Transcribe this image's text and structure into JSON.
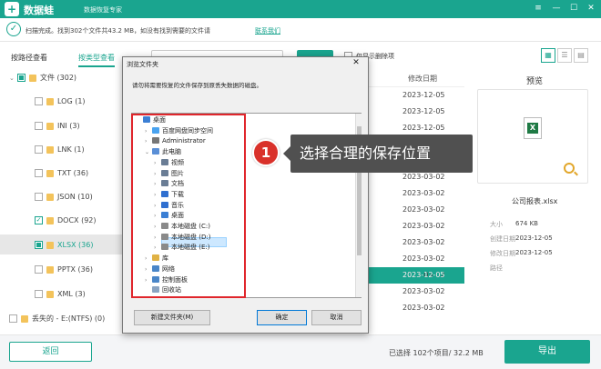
{
  "app": {
    "name": "数据蛙",
    "subtitle": "数据恢复专家",
    "logo": "+"
  },
  "window_controls": {
    "menu": "≡",
    "minimize": "—",
    "maximize": "☐",
    "close": "✕"
  },
  "status": {
    "text": "扫描完成。找到302个文件共43.2 MB，如没有找到需要的文件请",
    "link": "联系我们"
  },
  "tabs": [
    {
      "label": "按路径查看"
    },
    {
      "label": "按类型查看"
    }
  ],
  "toolbar": {
    "checkbox_label": "仅显示删除项"
  },
  "view_buttons": [
    "▦",
    "☰",
    "▤"
  ],
  "tree": {
    "root_label": "文件 (302)",
    "items": [
      {
        "label": "LOG (1)",
        "checked": false
      },
      {
        "label": "INI (3)",
        "checked": false
      },
      {
        "label": "LNK (1)",
        "checked": false
      },
      {
        "label": "TXT (36)",
        "checked": false
      },
      {
        "label": "JSON (10)",
        "checked": false
      },
      {
        "label": "DOCX (92)",
        "checked": true
      },
      {
        "label": "XLSX (36)",
        "checked": true
      },
      {
        "label": "PPTX (36)",
        "checked": false
      },
      {
        "label": "XML (3)",
        "checked": false
      }
    ],
    "lost_label": "丢失的 - E:(NTFS) (0)"
  },
  "list": {
    "header": "修改日期",
    "dates": [
      "2023-12-05",
      "2023-12-05",
      "2023-12-05",
      "2023-12-05",
      "2023-03-02",
      "2023-03-02",
      "2023-03-02",
      "2023-03-02",
      "2023-03-02",
      "2023-03-02",
      "2023-03-02",
      "2023-03-02",
      "2023-12-05",
      "2023-03-02",
      "2023-03-02"
    ]
  },
  "preview": {
    "title": "预览",
    "file_name": "公司报表.xlsx",
    "icon": "X",
    "rows": [
      {
        "label": "大小",
        "value": "674 KB"
      },
      {
        "label": "创建日期",
        "value": "2023-12-05"
      },
      {
        "label": "修改日期",
        "value": "2023-12-05"
      },
      {
        "label": "路径",
        "value": ""
      }
    ]
  },
  "footer": {
    "back": "返回",
    "selected": "已选择 102个项目/ 32.2 MB",
    "export": "导出"
  },
  "dialog": {
    "title": "浏览文件夹",
    "close": "✕",
    "description": "请勿将需要恢复的文件保存到原丢失数据的磁盘。",
    "tree": [
      {
        "label": "桌面",
        "level": 0,
        "arrow": "",
        "color": "#3b7fd4"
      },
      {
        "label": "百度网盘同步空间",
        "level": 1,
        "arrow": "›",
        "color": "#4aa3f0"
      },
      {
        "label": "Administrator",
        "level": 1,
        "arrow": "›",
        "color": "#777777"
      },
      {
        "label": "此电脑",
        "level": 1,
        "arrow": "⌄",
        "color": "#5a8fd6"
      },
      {
        "label": "视频",
        "level": 2,
        "arrow": "›",
        "color": "#6a7d95"
      },
      {
        "label": "图片",
        "level": 2,
        "arrow": "›",
        "color": "#6a7d95"
      },
      {
        "label": "文档",
        "level": 2,
        "arrow": "›",
        "color": "#6a7d95"
      },
      {
        "label": "下载",
        "level": 2,
        "arrow": "›",
        "color": "#2f6fd0"
      },
      {
        "label": "音乐",
        "level": 2,
        "arrow": "›",
        "color": "#2f6fd0"
      },
      {
        "label": "桌面",
        "level": 2,
        "arrow": "›",
        "color": "#3b7fd4"
      },
      {
        "label": "本地磁盘 (C:)",
        "level": 2,
        "arrow": "›",
        "color": "#8a8a8a"
      },
      {
        "label": "本地磁盘 (D:)",
        "level": 2,
        "arrow": "›",
        "color": "#8a8a8a"
      },
      {
        "label": "本地磁盘 (E:)",
        "level": 2,
        "arrow": "›",
        "color": "#8a8a8a"
      },
      {
        "label": "库",
        "level": 1,
        "arrow": "›",
        "color": "#e0b245"
      },
      {
        "label": "网络",
        "level": 1,
        "arrow": "›",
        "color": "#4a86c8"
      },
      {
        "label": "控制面板",
        "level": 1,
        "arrow": "›",
        "color": "#4a86c8"
      },
      {
        "label": "回收站",
        "level": 1,
        "arrow": "",
        "color": "#8aa4c2"
      }
    ],
    "new_folder": "新建文件夹(M)",
    "ok": "确定",
    "cancel": "取消"
  },
  "callout": {
    "number": "1",
    "text": "选择合理的保存位置"
  },
  "colors": {
    "accent": "#1aa58f",
    "highlight": "#e0262c"
  }
}
